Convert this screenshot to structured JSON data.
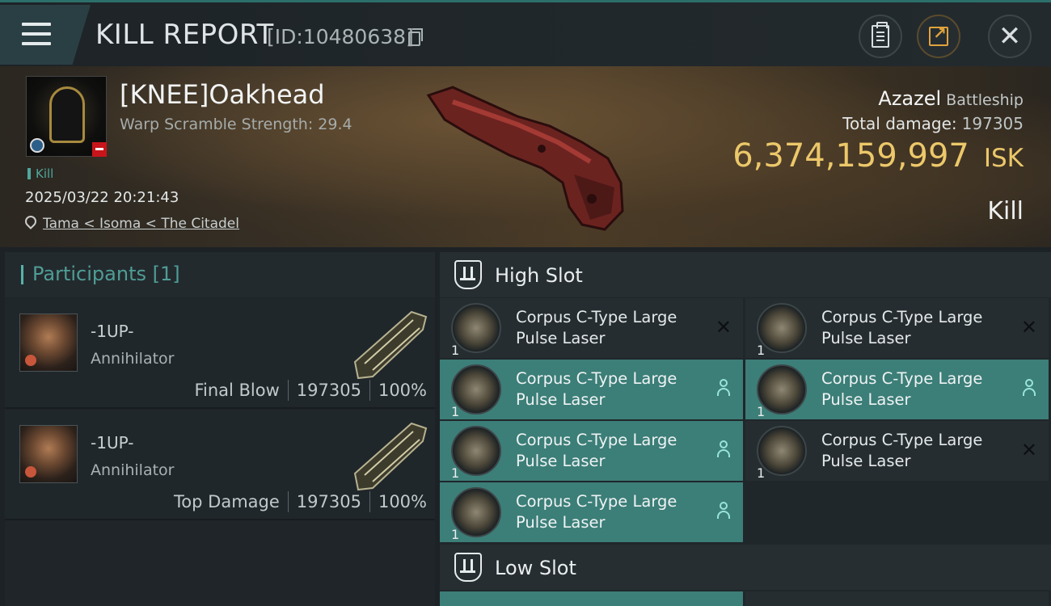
{
  "window": {
    "title": "KILL REPORT",
    "report_id": "[ID:10480638]",
    "buttons": [
      "clipboard-icon",
      "share-icon",
      "close-icon"
    ]
  },
  "victim": {
    "name": "[KNEE]Oakhead",
    "warp_scramble": "Warp Scramble Strength: 29.4",
    "tag": "Kill",
    "datetime": "2025/03/22 20:21:43",
    "location": "Tama < Isoma < The Citadel",
    "ship_name": "Azazel",
    "ship_class": "Battleship",
    "total_damage_label": "Total damage:",
    "total_damage_value": "197305",
    "isk_value": "6,374,159,997",
    "isk_unit": "ISK",
    "result": "Kill"
  },
  "participants": {
    "header": "Participants [1]",
    "rows": [
      {
        "name": "-1UP-",
        "ship": "Annihilator",
        "role": "Final Blow",
        "damage": "197305",
        "percent": "100%"
      },
      {
        "name": "-1UP-",
        "ship": "Annihilator",
        "role": "Top Damage",
        "damage": "197305",
        "percent": "100%"
      }
    ]
  },
  "fitting": {
    "high_slot_label": "High Slot",
    "low_slot_label": "Low Slot",
    "high_modules": [
      {
        "name": "Corpus C-Type Large Pulse Laser",
        "qty": "1",
        "state": "destroyed"
      },
      {
        "name": "Corpus C-Type Large Pulse Laser",
        "qty": "1",
        "state": "destroyed"
      },
      {
        "name": "Corpus C-Type Large Pulse Laser",
        "qty": "1",
        "state": "dropped"
      },
      {
        "name": "Corpus C-Type Large Pulse Laser",
        "qty": "1",
        "state": "dropped"
      },
      {
        "name": "Corpus C-Type Large Pulse Laser",
        "qty": "1",
        "state": "dropped"
      },
      {
        "name": "Corpus C-Type Large Pulse Laser",
        "qty": "1",
        "state": "destroyed"
      },
      {
        "name": "Corpus C-Type Large Pulse Laser",
        "qty": "1",
        "state": "dropped"
      }
    ]
  },
  "colors": {
    "accent": "#3c7e78",
    "isk": "#ecc86a",
    "teal_text": "#4f9d95",
    "destroyed_row": "#262d31"
  }
}
